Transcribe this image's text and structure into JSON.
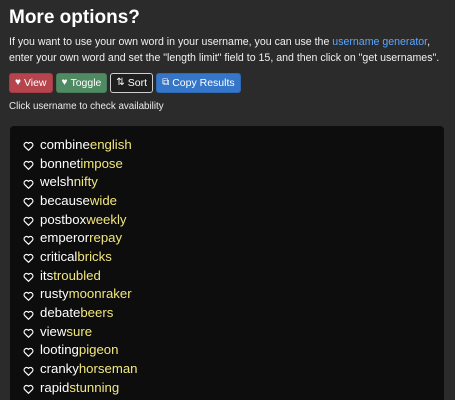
{
  "heading": "More options?",
  "intro": {
    "before": "If you want to use your own word in your username, you can use the ",
    "link": "username generator",
    "after": ", enter your own word and set the \"length limit\" field to 15, and then click on \"get usernames\"."
  },
  "buttons": {
    "view": "View",
    "toggle": "Toggle",
    "sort": "Sort",
    "copy": "Copy Results"
  },
  "hint": "Click username to check availability",
  "colors": {
    "background": "#2b2b2c",
    "result_box": "#0d0d0d",
    "first_word": "#ffffff",
    "second_word": "#f2e77c",
    "link": "#5aa7ff",
    "view": "#b5444d",
    "toggle": "#4f8a63",
    "copy": "#3576c9"
  },
  "usernames": [
    {
      "first": "combine",
      "second": "english"
    },
    {
      "first": "bonnet",
      "second": "impose"
    },
    {
      "first": "welsh",
      "second": "nifty"
    },
    {
      "first": "because",
      "second": "wide"
    },
    {
      "first": "postbox",
      "second": "weekly"
    },
    {
      "first": "emperor",
      "second": "repay"
    },
    {
      "first": "critical",
      "second": "bricks"
    },
    {
      "first": "its",
      "second": "troubled"
    },
    {
      "first": "rusty",
      "second": "moonraker"
    },
    {
      "first": "debate",
      "second": "beers"
    },
    {
      "first": "view",
      "second": "sure"
    },
    {
      "first": "looting",
      "second": "pigeon"
    },
    {
      "first": "cranky",
      "second": "horseman"
    },
    {
      "first": "rapid",
      "second": "stunning"
    }
  ]
}
